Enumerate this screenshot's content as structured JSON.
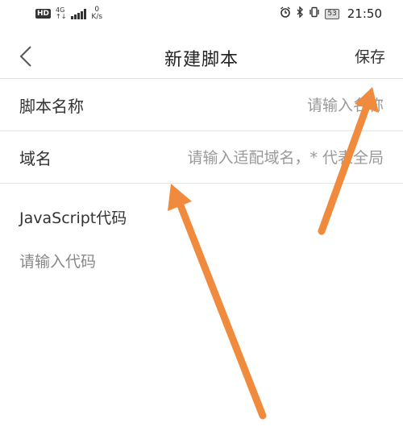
{
  "status_bar": {
    "network_badge": "HD",
    "network_type": "4G",
    "network_sub": "↑↓",
    "speed_value": "0",
    "speed_unit": "K/s",
    "battery": "53",
    "time": "21:50"
  },
  "header": {
    "title": "新建脚本",
    "save_label": "保存"
  },
  "form": {
    "name_label": "脚本名称",
    "name_placeholder": "请输入名称",
    "domain_label": "域名",
    "domain_placeholder": "请输入适配域名，* 代表全局",
    "code_label": "JavaScript代码",
    "code_placeholder": "请输入代码"
  },
  "colors": {
    "annotation_arrow": "#F08A3C"
  }
}
